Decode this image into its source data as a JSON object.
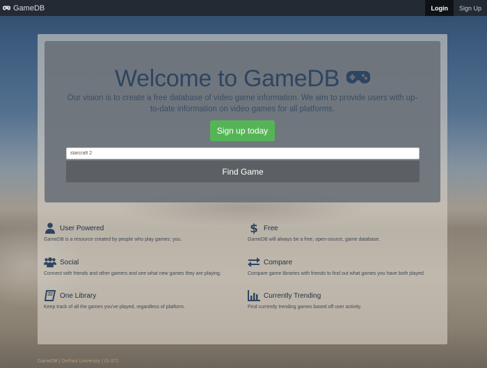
{
  "navbar": {
    "brand": "GameDB",
    "brand_icon": "gamepad-icon",
    "links": [
      {
        "label": "Login",
        "active": true
      },
      {
        "label": "Sign Up",
        "active": false
      }
    ]
  },
  "hero": {
    "title": "Welcome to GameDB",
    "title_icon": "gamepad-icon",
    "vision": "Our vision is to create a free database of video game information. We aim to provide users with up-to-date information on video games for all platforms.",
    "signup_label": "Sign up today",
    "search_value": "starcraft 2",
    "find_label": "Find Game"
  },
  "features": [
    {
      "title": "User Powered",
      "icon": "user-icon",
      "desc": "GameDB is a resource created by people who play games: you."
    },
    {
      "title": "Free",
      "icon": "dollar-icon",
      "desc": "GameDB will always be a free, open-source, game database."
    },
    {
      "title": "Social",
      "icon": "users-icon",
      "desc": "Connect with friends and other gamers and see what new games they are playing."
    },
    {
      "title": "Compare",
      "icon": "exchange-icon",
      "desc": "Compare game libraries with friends to find out what games you have both played."
    },
    {
      "title": "One Library",
      "icon": "book-icon",
      "desc": "Keep track of all the games you've played, regardless of platform."
    },
    {
      "title": "Currently Trending",
      "icon": "bar-chart-icon",
      "desc": "Find currently trending games based off user activity."
    }
  ],
  "footer": {
    "brand": "GameDB",
    "university": "DePaul University",
    "course": "IS-372",
    "separator": "|"
  },
  "colors": {
    "accent_green": "#55b556",
    "title_blue": "#2e4561",
    "navbar": "#232a33"
  }
}
